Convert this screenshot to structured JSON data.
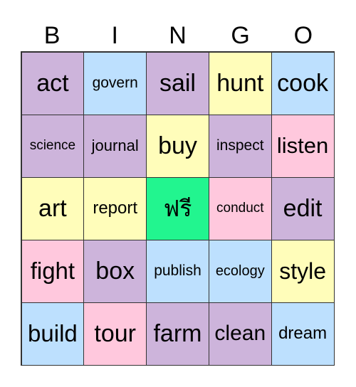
{
  "header": [
    "B",
    "I",
    "N",
    "G",
    "O"
  ],
  "colors": {
    "purple": "#CDB4DB",
    "blue": "#BDE0FE",
    "yellow": "#FFFDBA",
    "pink": "#FFC8DD",
    "green": "#22F58F"
  },
  "cells": [
    {
      "text": "act",
      "color": "purple",
      "size": 34
    },
    {
      "text": "govern",
      "color": "blue",
      "size": 21
    },
    {
      "text": "sail",
      "color": "purple",
      "size": 34
    },
    {
      "text": "hunt",
      "color": "yellow",
      "size": 34
    },
    {
      "text": "cook",
      "color": "blue",
      "size": 34
    },
    {
      "text": "science",
      "color": "purple",
      "size": 19
    },
    {
      "text": "journal",
      "color": "purple",
      "size": 22
    },
    {
      "text": "buy",
      "color": "yellow",
      "size": 34
    },
    {
      "text": "inspect",
      "color": "purple",
      "size": 21
    },
    {
      "text": "listen",
      "color": "pink",
      "size": 31
    },
    {
      "text": "art",
      "color": "yellow",
      "size": 34
    },
    {
      "text": "report",
      "color": "yellow",
      "size": 24
    },
    {
      "text": "ฟรี",
      "color": "green",
      "size": 32
    },
    {
      "text": "conduct",
      "color": "pink",
      "size": 19
    },
    {
      "text": "edit",
      "color": "purple",
      "size": 34
    },
    {
      "text": "fight",
      "color": "pink",
      "size": 33
    },
    {
      "text": "box",
      "color": "purple",
      "size": 34
    },
    {
      "text": "publish",
      "color": "blue",
      "size": 21
    },
    {
      "text": "ecology",
      "color": "blue",
      "size": 20
    },
    {
      "text": "style",
      "color": "yellow",
      "size": 32
    },
    {
      "text": "build",
      "color": "blue",
      "size": 33
    },
    {
      "text": "tour",
      "color": "pink",
      "size": 34
    },
    {
      "text": "farm",
      "color": "purple",
      "size": 34
    },
    {
      "text": "clean",
      "color": "purple",
      "size": 30
    },
    {
      "text": "dream",
      "color": "blue",
      "size": 24
    }
  ]
}
